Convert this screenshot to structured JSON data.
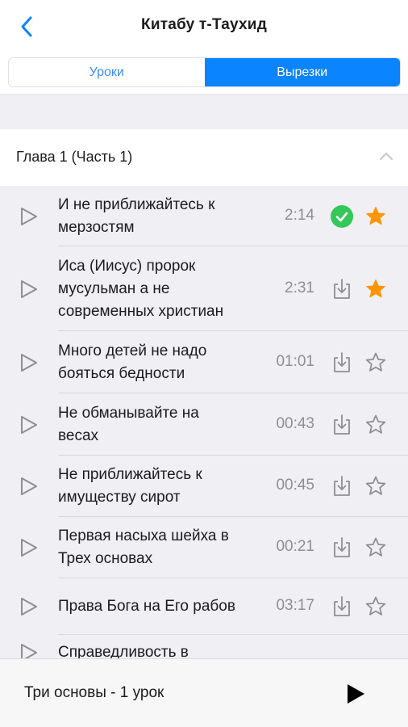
{
  "header": {
    "title": "Китабу т-Таухид",
    "back_icon": "chevron-left-icon",
    "accent": "#0a84ff"
  },
  "tabs": [
    {
      "label": "Уроки",
      "active": false
    },
    {
      "label": "Вырезки",
      "active": true
    }
  ],
  "chapter": {
    "title": "Глава 1 (Часть 1)",
    "expanded": true,
    "icon": "chevron-up-icon"
  },
  "items": [
    {
      "title_lines": [
        "И не приближайтесь к",
        "мерзостям"
      ],
      "duration": "2:14",
      "status": "downloaded",
      "favorite": true
    },
    {
      "title_lines": [
        "Иса (Иисус) пророк",
        "мусульман а не",
        "современных христиан"
      ],
      "duration": "2:31",
      "status": "download",
      "favorite": true
    },
    {
      "title_lines": [
        "Много детей не надо",
        "бояться бедности"
      ],
      "duration": "01:01",
      "status": "download",
      "favorite": false
    },
    {
      "title_lines": [
        "Не обманывайте на",
        "весах"
      ],
      "duration": "00:43",
      "status": "download",
      "favorite": false
    },
    {
      "title_lines": [
        "Не приближайтесь к",
        "имуществу сирот"
      ],
      "duration": "00:45",
      "status": "download",
      "favorite": false
    },
    {
      "title_lines": [
        "Первая насыха шейха в",
        "Трех основах"
      ],
      "duration": "00:21",
      "status": "download",
      "favorite": false
    },
    {
      "title_lines": [
        "Права Бога на Его рабов"
      ],
      "duration": "03:17",
      "status": "download",
      "favorite": false
    },
    {
      "title_lines": [
        "Справедливость в"
      ],
      "duration": "",
      "status": "",
      "favorite": false
    }
  ],
  "colors": {
    "downloaded": "#34c759",
    "favorite": "#ff9500",
    "icon_gray": "#8e8e93"
  },
  "player": {
    "title": "Три основы - 1 урок",
    "play_icon": "play-icon"
  }
}
